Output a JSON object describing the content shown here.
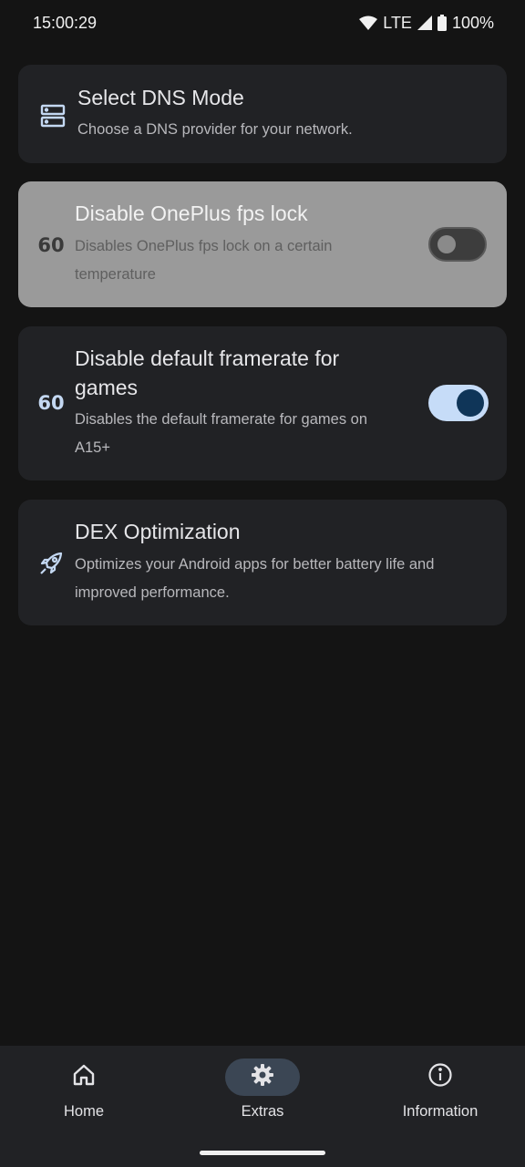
{
  "status_bar": {
    "time": "15:00:29",
    "network": "LTE",
    "battery": "100%"
  },
  "cards": [
    {
      "title": "Select DNS Mode",
      "subtitle": "Choose a DNS provider for your network.",
      "icon": "dns-server-icon"
    },
    {
      "title": "Disable OnePlus fps lock",
      "subtitle_line1": "Disables OnePlus fps lock on a certain",
      "subtitle_line2": "temperature",
      "icon_text": "60",
      "toggle": "off",
      "enabled": false
    },
    {
      "title_line1": "Disable default framerate for",
      "title_line2": "games",
      "subtitle_line1": "Disables the default framerate for games on",
      "subtitle_line2": "A15+",
      "icon_text": "60",
      "toggle": "on"
    },
    {
      "title": "DEX Optimization",
      "subtitle_line1": "Optimizes your Android apps for better battery life and",
      "subtitle_line2": "improved performance.",
      "icon": "rocket-icon"
    }
  ],
  "nav": {
    "items": [
      {
        "label": "Home",
        "icon": "home-icon"
      },
      {
        "label": "Extras",
        "icon": "gear-icon",
        "active": true
      },
      {
        "label": "Information",
        "icon": "info-icon"
      }
    ]
  },
  "colors": {
    "background": "#141414",
    "card": "#212225",
    "disabled_card": "#9a9a9a",
    "accent": "#c6dcf8",
    "accent_dark": "#0f3558"
  }
}
